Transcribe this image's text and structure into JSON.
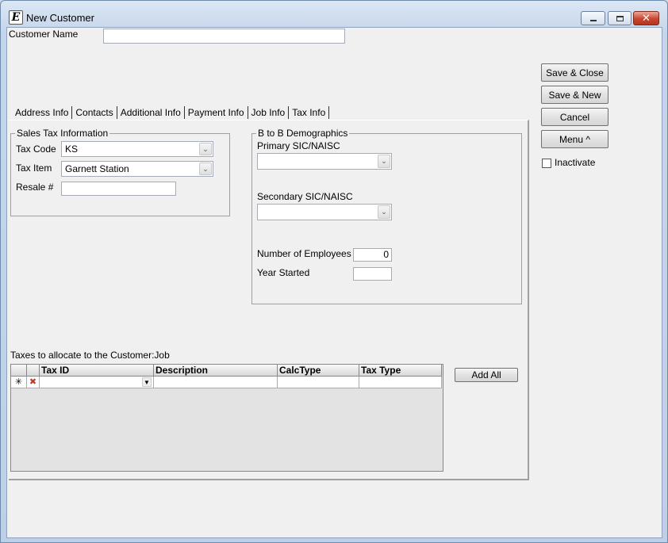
{
  "window": {
    "title": "New Customer",
    "app_icon_glyph": "E",
    "minimize_icon": "minimize-icon",
    "maximize_icon": "maximize-icon",
    "close_icon": "close-icon"
  },
  "customer_name": {
    "label": "Customer Name",
    "value": ""
  },
  "buttons": {
    "save_close": "Save & Close",
    "save_new": "Save & New",
    "cancel": "Cancel",
    "menu": "Menu ^"
  },
  "inactivate": {
    "label": "Inactivate",
    "checked": false
  },
  "tabs": [
    {
      "label": "Address Info",
      "active": false
    },
    {
      "label": "Contacts",
      "active": false
    },
    {
      "label": "Additional Info",
      "active": false
    },
    {
      "label": "Payment Info",
      "active": false
    },
    {
      "label": "Job Info",
      "active": false
    },
    {
      "label": "Tax Info",
      "active": true
    }
  ],
  "sales_tax": {
    "legend": "Sales Tax Information",
    "tax_code_label": "Tax Code",
    "tax_code_value": "KS",
    "tax_item_label": "Tax Item",
    "tax_item_value": "Garnett Station",
    "resale_label": "Resale #",
    "resale_value": ""
  },
  "demographics": {
    "legend": "B to B Demographics",
    "primary_label": "Primary SIC/NAISC",
    "primary_value": "",
    "secondary_label": "Secondary SIC/NAISC",
    "secondary_value": "",
    "employees_label": "Number of Employees",
    "employees_value": "0",
    "year_label": "Year Started",
    "year_value": ""
  },
  "taxes_grid": {
    "caption": "Taxes to allocate to the Customer:Job",
    "columns": [
      "Tax ID",
      "Description",
      "CalcType",
      "Tax Type"
    ],
    "new_row_marker": "✳",
    "delete_marker": "✖",
    "add_all_label": "Add All"
  },
  "colors": {
    "accent_close": "#c8452f",
    "client_bg": "#f0f0f0"
  }
}
